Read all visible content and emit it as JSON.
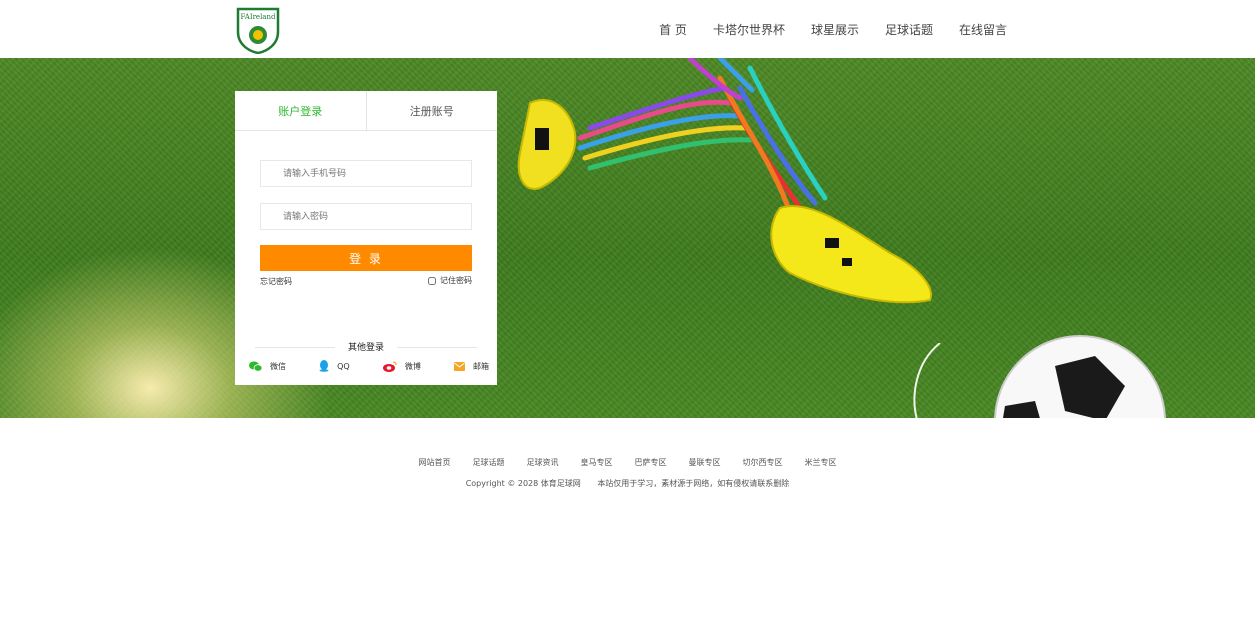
{
  "header": {
    "logo_text": "FAIreland",
    "nav": [
      "首 页",
      "卡塔尔世界杯",
      "球星展示",
      "足球话题",
      "在线留言"
    ]
  },
  "login": {
    "tabs": [
      "账户登录",
      "注册账号"
    ],
    "phone_placeholder": "请输入手机号码",
    "password_placeholder": "请输入密码",
    "submit_label": "登 录",
    "forgot_label": "忘记密码",
    "remember_label": "记住密码",
    "other_title": "其他登录",
    "socials": [
      "微信",
      "QQ",
      "微博",
      "邮箱"
    ]
  },
  "footer": {
    "links": [
      "网站首页",
      "足球话题",
      "足球资讯",
      "皇马专区",
      "巴萨专区",
      "曼联专区",
      "切尔西专区",
      "米兰专区"
    ],
    "copyright": "Copyright © 2028 体育足球网",
    "notice": "本站仅用于学习，素材源于网络，如有侵权请联系删除"
  },
  "colors": {
    "accent_green": "#2eb82e",
    "login_button": "#ff8a00",
    "grass": "#4a8a24"
  }
}
